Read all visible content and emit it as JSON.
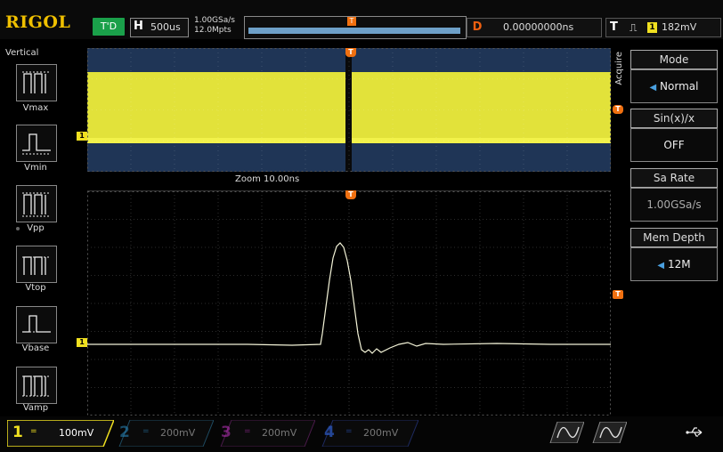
{
  "header": {
    "brand": "RIGOL",
    "run_state": "T'D",
    "timebase_label": "H",
    "timebase_value": "500us",
    "sample_rate": "1.00GSa/s",
    "memory_points": "12.0Mpts",
    "delay_label": "D",
    "delay_value": "0.00000000ns",
    "trigger_label": "T",
    "trigger_edge_icon": "rising-edge-icon",
    "trigger_source": "1",
    "trigger_level": "182mV"
  },
  "vertical_panel": {
    "title": "Vertical",
    "items": [
      {
        "label": "Vmax",
        "icon": "vmax-icon"
      },
      {
        "label": "Vmin",
        "icon": "vmin-icon"
      },
      {
        "label": "Vpp",
        "icon": "vpp-icon"
      },
      {
        "label": "Vtop",
        "icon": "vtop-icon"
      },
      {
        "label": "Vbase",
        "icon": "vbase-icon"
      },
      {
        "label": "Vamp",
        "icon": "vamp-icon"
      }
    ]
  },
  "display": {
    "zoom_label": "Zoom 10.00ns",
    "channel_marker": "1",
    "trigger_marker": "T"
  },
  "acquire_menu": {
    "title": "Acquire",
    "items": [
      {
        "title": "Mode",
        "value": "Normal"
      },
      {
        "title": "Sin(x)/x",
        "value": "OFF"
      },
      {
        "title": "Sa Rate",
        "value": "1.00GSa/s"
      },
      {
        "title": "Mem Depth",
        "value": "12M"
      }
    ]
  },
  "channels": [
    {
      "number": "1",
      "coupling": "=",
      "scale": "100mV",
      "color": "#f0e020"
    },
    {
      "number": "2",
      "coupling": "=",
      "scale": "200mV",
      "color": "#2a8ac0"
    },
    {
      "number": "3",
      "coupling": "=",
      "scale": "200mV",
      "color": "#b030b0"
    },
    {
      "number": "4",
      "coupling": "=",
      "scale": "200mV",
      "color": "#3060d0"
    }
  ],
  "colors": {
    "ch1": "#f0e020",
    "trigger": "#f07010",
    "upper_bg": "#1f3556",
    "run": "#1aa04a"
  }
}
